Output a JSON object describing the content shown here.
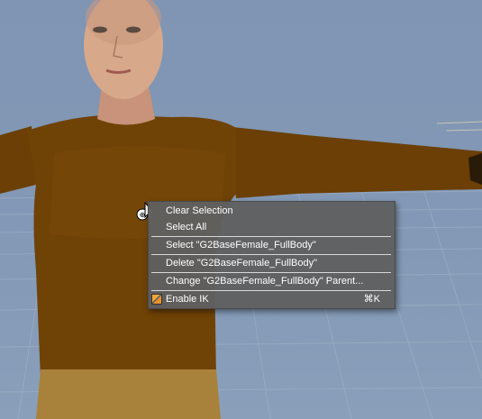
{
  "scene": {
    "background_color": "#8499b5",
    "grid_color": "#9fb0c6",
    "shirt_color": "#6b3f05",
    "pants_color": "#a8823a",
    "skin_color": "#d7a98a"
  },
  "context_menu": {
    "items": [
      {
        "label": "Clear Selection"
      },
      {
        "label": "Select All"
      },
      {
        "label": "Select \"G2BaseFemale_FullBody\""
      },
      {
        "label": "Delete \"G2BaseFemale_FullBody\""
      },
      {
        "label": "Change \"G2BaseFemale_FullBody\" Parent..."
      },
      {
        "label": "Enable IK",
        "shortcut": "⌘K",
        "icon": "ik-icon"
      }
    ]
  }
}
